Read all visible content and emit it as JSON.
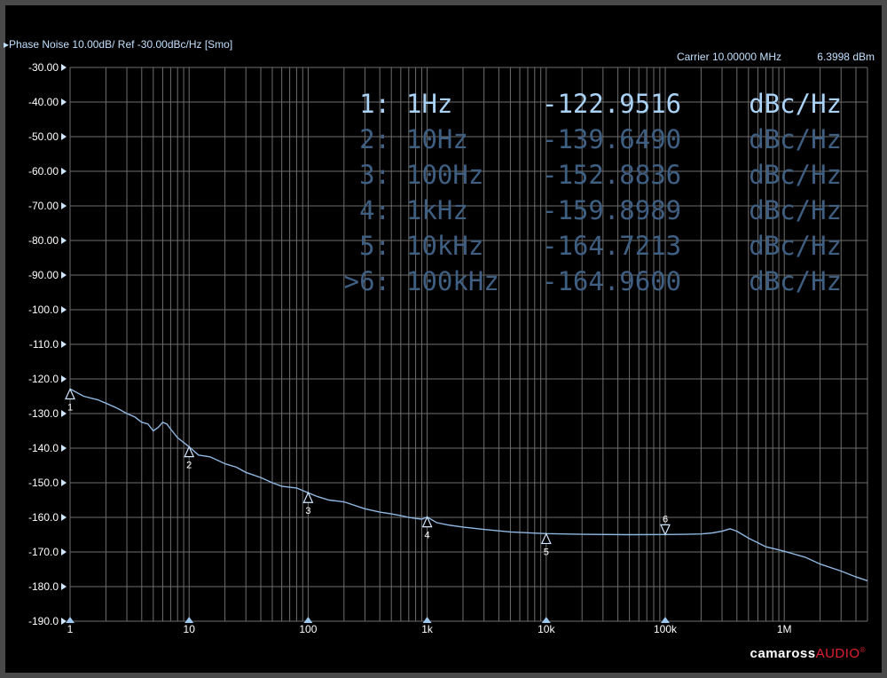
{
  "header": {
    "trace_title": "Phase Noise 10.00dB/ Ref -30.00dBc/Hz [Smo]",
    "carrier": "Carrier 10.00000 MHz",
    "carrier_power": "6.3998 dBm"
  },
  "brand": {
    "part1": "camaross",
    "part2": "AUDIO"
  },
  "colors": {
    "background": "#000000",
    "grid": "#6e6e6e",
    "trace": "#8fb8e2",
    "readout_active": "#a9d2f5",
    "readout_inactive": "#3f5f82",
    "brand_accent": "#e0202e"
  },
  "chart_data": {
    "type": "line",
    "title": "Phase Noise 10.00dB/ Ref -30.00dBc/Hz [Smo]",
    "xlabel": "",
    "ylabel": "",
    "x_scale": "log",
    "xlim": [
      1,
      5000000
    ],
    "ylim": [
      -190,
      -30
    ],
    "grid": true,
    "y_ticks": [
      "-30.00",
      "-40.00",
      "-50.00",
      "-60.00",
      "-70.00",
      "-80.00",
      "-90.00",
      "-100.0",
      "-110.0",
      "-120.0",
      "-130.0",
      "-140.0",
      "-150.0",
      "-160.0",
      "-170.0",
      "-180.0",
      "-190.0"
    ],
    "x_ticks": [
      {
        "value": 1,
        "label": "1"
      },
      {
        "value": 10,
        "label": "10"
      },
      {
        "value": 100,
        "label": "100"
      },
      {
        "value": 1000,
        "label": "1k"
      },
      {
        "value": 10000,
        "label": "10k"
      },
      {
        "value": 100000,
        "label": "100k"
      },
      {
        "value": 1000000,
        "label": "1M"
      }
    ],
    "series": [
      {
        "x": [
          1,
          1.3,
          1.7,
          2,
          2.5,
          3,
          3.5,
          4,
          4.5,
          5,
          5.5,
          6,
          6.5,
          7,
          8,
          10,
          12,
          15,
          20,
          25,
          30,
          40,
          50,
          60,
          80,
          100,
          120,
          150,
          200,
          300,
          400,
          500,
          600,
          700,
          800,
          900,
          1000,
          1200,
          1500,
          2000,
          3000,
          5000,
          10000,
          20000,
          50000,
          100000,
          150000,
          200000,
          250000,
          300000,
          350000,
          400000,
          500000,
          700000,
          1000000,
          1500000,
          2000000,
          3000000,
          4000000,
          5000000
        ],
        "y": [
          -122.9,
          -125,
          -126,
          -127,
          -128.5,
          -130,
          -131,
          -132.5,
          -133,
          -135,
          -134,
          -132.5,
          -133,
          -134.5,
          -137,
          -139.6,
          -142,
          -142.5,
          -144.5,
          -145.5,
          -147,
          -148.5,
          -150,
          -151,
          -151.5,
          -152.9,
          -154,
          -155,
          -155.5,
          -157.5,
          -158.5,
          -159,
          -159.5,
          -160,
          -160.3,
          -160.5,
          -159.9,
          -161.5,
          -162.2,
          -162.8,
          -163.5,
          -164.2,
          -164.7,
          -164.9,
          -165,
          -164.96,
          -164.9,
          -164.8,
          -164.5,
          -164,
          -163.3,
          -164,
          -166,
          -168.5,
          -169.8,
          -171.5,
          -173.5,
          -175.5,
          -177.2,
          -178.3
        ]
      }
    ],
    "markers": [
      {
        "label": "1",
        "x": 1,
        "y": -122.9516,
        "dir": "up"
      },
      {
        "label": "2",
        "x": 10,
        "y": -139.649,
        "dir": "up"
      },
      {
        "label": "3",
        "x": 100,
        "y": -152.8836,
        "dir": "up"
      },
      {
        "label": "4",
        "x": 1000,
        "y": -159.8989,
        "dir": "up"
      },
      {
        "label": "5",
        "x": 10000,
        "y": -164.7213,
        "dir": "up"
      },
      {
        "label": "6",
        "x": 100000,
        "y": -164.96,
        "dir": "down"
      }
    ],
    "readouts": [
      {
        "id": "1:",
        "freq": "1Hz",
        "value": "-122.9516",
        "unit": "dBc/Hz",
        "active": true
      },
      {
        "id": "2:",
        "freq": "10Hz",
        "value": "-139.6490",
        "unit": "dBc/Hz",
        "active": false
      },
      {
        "id": "3:",
        "freq": "100Hz",
        "value": "-152.8836",
        "unit": "dBc/Hz",
        "active": false
      },
      {
        "id": "4:",
        "freq": "1kHz",
        "value": "-159.8989",
        "unit": "dBc/Hz",
        "active": false
      },
      {
        "id": "5:",
        "freq": "10kHz",
        "value": "-164.7213",
        "unit": "dBc/Hz",
        "active": false
      },
      {
        "id": ">6:",
        "freq": "100kHz",
        "value": "-164.9600",
        "unit": "dBc/Hz",
        "active": false
      }
    ]
  }
}
